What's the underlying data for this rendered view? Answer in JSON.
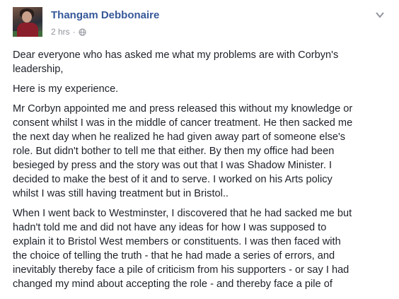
{
  "post": {
    "author": "Thangam Debbonaire",
    "timestamp": "2 hrs",
    "separator": "·",
    "privacy_icon": "globe-icon",
    "menu_icon": "chevron-down-icon",
    "paragraphs": [
      "Dear everyone who has asked me what my problems are with Corbyn's\nleadership,",
      "Here is my experience.",
      "Mr Corbyn appointed me and press released this without my knowledge or\nconsent whilst I was in the middle of cancer treatment. He then sacked me\nthe next day when he realized he had given away part of someone else's\nrole. But didn't bother to tell me that either. By then my office had been\nbesieged by press and the story was out that I was Shadow Minister. I\ndecided to make the best of it and to serve. I worked on his Arts policy\nwhilst I was still having treatment but in Bristol..",
      "When I went back to Westminster, I discovered that he had sacked me but\nhadn't told me and did not have any ideas for how I was supposed to\nexplain it to Bristol West members or constituents. I was then faced with\nthe choice of telling the truth - that he had made a series of errors, and\ninevitably thereby face a pile of criticism from his supporters - or say I had\nchanged my mind about accepting the role - and thereby face a pile of"
    ]
  },
  "colors": {
    "name_link": "#365899",
    "meta_text": "#90949c",
    "body_text": "#1d2129"
  }
}
